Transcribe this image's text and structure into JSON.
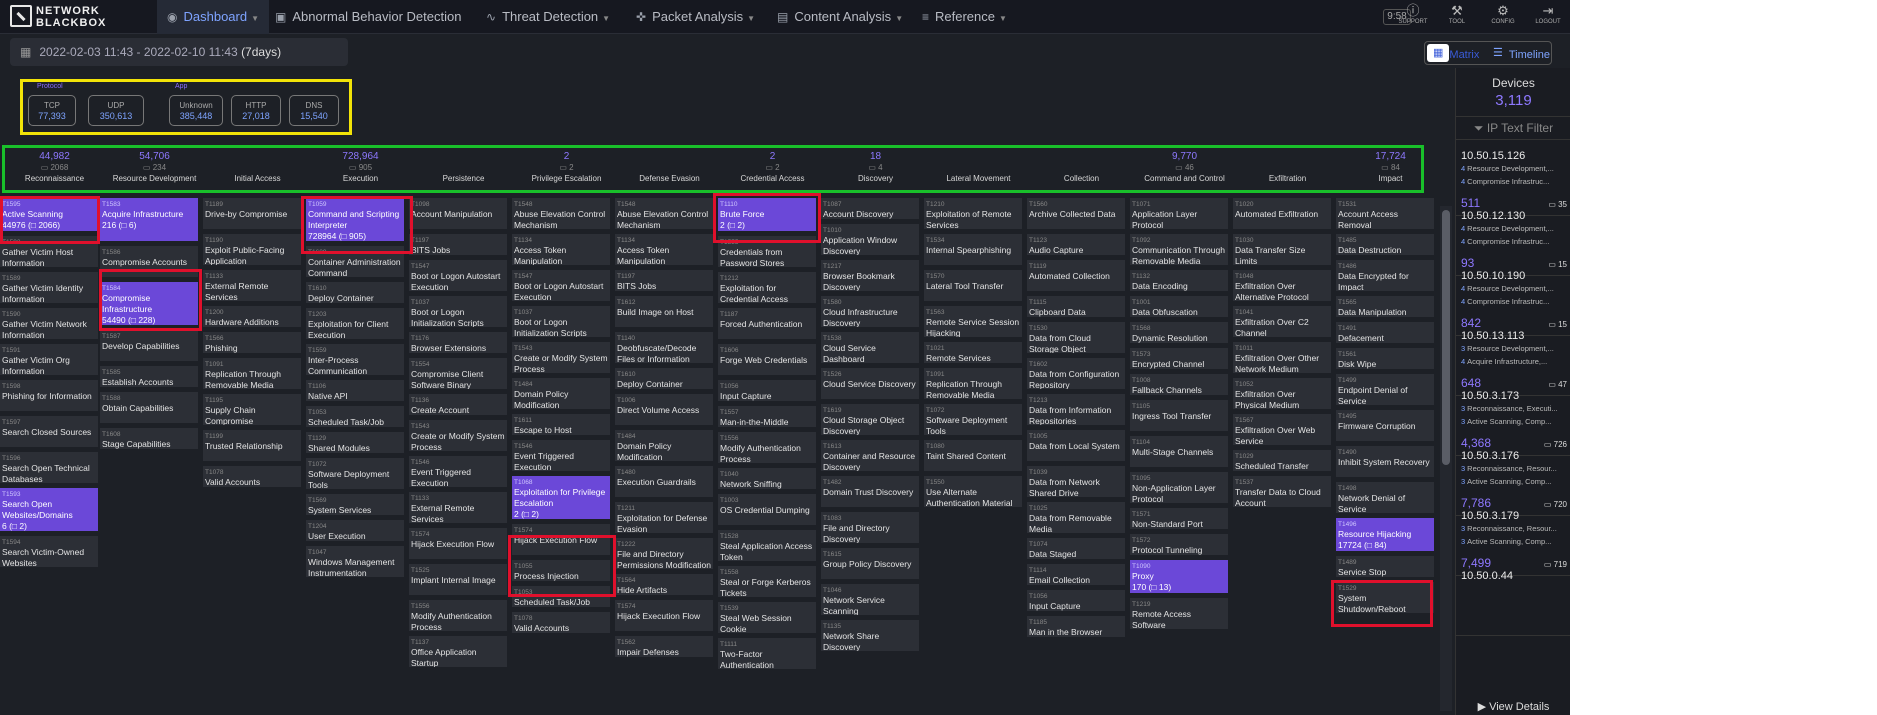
{
  "brand": {
    "line1": "NETWORK",
    "line2": "BLACKBOX"
  },
  "nav": [
    {
      "label": "Dashboard",
      "icon": "◉"
    },
    {
      "label": "Abnormal Behavior Detection",
      "icon": "▣"
    },
    {
      "label": "Threat Detection",
      "icon": "∿"
    },
    {
      "label": "Packet Analysis",
      "icon": "✜"
    },
    {
      "label": "Content Analysis",
      "icon": "▤"
    },
    {
      "label": "Reference",
      "icon": "≡"
    }
  ],
  "clock": "9:58",
  "tools": [
    {
      "label": "SUPPORT",
      "icon": "ⓘ"
    },
    {
      "label": "TOOL",
      "icon": "⚒"
    },
    {
      "label": "CONFIG",
      "icon": "⚙"
    },
    {
      "label": "LOGOUT",
      "icon": "⇥"
    }
  ],
  "date_range": "2022-02-03 11:43 - 2022-02-10 11:43",
  "date_span": "(7days)",
  "view": {
    "matrix": "Matrix",
    "timeline": "Timeline"
  },
  "protocol": {
    "group_protocol": "Protocol",
    "group_app": "App",
    "items": [
      {
        "name": "TCP",
        "value": "77,393"
      },
      {
        "name": "UDP",
        "value": "350,613"
      },
      {
        "name": "Unknown",
        "value": "385,448"
      },
      {
        "name": "HTTP",
        "value": "27,018"
      },
      {
        "name": "DNS",
        "value": "15,540"
      }
    ]
  },
  "tactics": [
    {
      "name": "Reconnaissance",
      "count": "44,982",
      "sub": "2068"
    },
    {
      "name": "Resource Development",
      "count": "54,706",
      "sub": "234"
    },
    {
      "name": "Initial Access",
      "count": "",
      "sub": ""
    },
    {
      "name": "Execution",
      "count": "728,964",
      "sub": "905"
    },
    {
      "name": "Persistence",
      "count": "",
      "sub": ""
    },
    {
      "name": "Privilege Escalation",
      "count": "2",
      "sub": "2"
    },
    {
      "name": "Defense Evasion",
      "count": "",
      "sub": ""
    },
    {
      "name": "Credential Access",
      "count": "2",
      "sub": "2"
    },
    {
      "name": "Discovery",
      "count": "18",
      "sub": "4"
    },
    {
      "name": "Lateral Movement",
      "count": "",
      "sub": ""
    },
    {
      "name": "Collection",
      "count": "",
      "sub": ""
    },
    {
      "name": "Command and Control",
      "count": "9,770",
      "sub": "46"
    },
    {
      "name": "Exfiltration",
      "count": "",
      "sub": ""
    },
    {
      "name": "Impact",
      "count": "17,724",
      "sub": "84"
    }
  ],
  "matrix": [
    [
      {
        "id": "T1595",
        "name": "Active Scanning",
        "count": "44976 (□ 2066)",
        "hot": true
      },
      {
        "id": "T1592",
        "name": "Gather Victim Host Information"
      },
      {
        "id": "T1589",
        "name": "Gather Victim Identity Information"
      },
      {
        "id": "T1590",
        "name": "Gather Victim Network Information"
      },
      {
        "id": "T1591",
        "name": "Gather Victim Org Information"
      },
      {
        "id": "T1598",
        "name": "Phishing for Information"
      },
      {
        "id": "T1597",
        "name": "Search Closed Sources"
      },
      {
        "id": "T1596",
        "name": "Search Open Technical Databases"
      },
      {
        "id": "T1593",
        "name": "Search Open Websites/Domains",
        "count": "6 (□ 2)",
        "hot": true
      },
      {
        "id": "T1594",
        "name": "Search Victim-Owned Websites"
      }
    ],
    [
      {
        "id": "T1583",
        "name": "Acquire Infrastructure",
        "count": "216 (□ 6)",
        "hot": true
      },
      {
        "id": "T1586",
        "name": "Compromise Accounts"
      },
      {
        "id": "T1584",
        "name": "Compromise Infrastructure",
        "count": "54490 (□ 228)",
        "hot": true
      },
      {
        "id": "T1587",
        "name": "Develop Capabilities"
      },
      {
        "id": "T1585",
        "name": "Establish Accounts"
      },
      {
        "id": "T1588",
        "name": "Obtain Capabilities"
      },
      {
        "id": "T1608",
        "name": "Stage Capabilities"
      }
    ],
    [
      {
        "id": "T1189",
        "name": "Drive-by Compromise"
      },
      {
        "id": "T1190",
        "name": "Exploit Public-Facing Application"
      },
      {
        "id": "T1133",
        "name": "External Remote Services"
      },
      {
        "id": "T1200",
        "name": "Hardware Additions"
      },
      {
        "id": "T1566",
        "name": "Phishing"
      },
      {
        "id": "T1091",
        "name": "Replication Through Removable Media"
      },
      {
        "id": "T1195",
        "name": "Supply Chain Compromise"
      },
      {
        "id": "T1199",
        "name": "Trusted Relationship"
      },
      {
        "id": "T1078",
        "name": "Valid Accounts"
      }
    ],
    [
      {
        "id": "T1059",
        "name": "Command and Scripting Interpreter",
        "count": "728964 (□ 905)",
        "hot": true
      },
      {
        "id": "T1609",
        "name": "Container Administration Command"
      },
      {
        "id": "T1610",
        "name": "Deploy Container"
      },
      {
        "id": "T1203",
        "name": "Exploitation for Client Execution"
      },
      {
        "id": "T1559",
        "name": "Inter-Process Communication"
      },
      {
        "id": "T1106",
        "name": "Native API"
      },
      {
        "id": "T1053",
        "name": "Scheduled Task/Job"
      },
      {
        "id": "T1129",
        "name": "Shared Modules"
      },
      {
        "id": "T1072",
        "name": "Software Deployment Tools"
      },
      {
        "id": "T1569",
        "name": "System Services"
      },
      {
        "id": "T1204",
        "name": "User Execution"
      },
      {
        "id": "T1047",
        "name": "Windows Management Instrumentation"
      }
    ],
    [
      {
        "id": "T1098",
        "name": "Account Manipulation"
      },
      {
        "id": "T1197",
        "name": "BITS Jobs"
      },
      {
        "id": "T1547",
        "name": "Boot or Logon Autostart Execution"
      },
      {
        "id": "T1037",
        "name": "Boot or Logon Initialization Scripts"
      },
      {
        "id": "T1176",
        "name": "Browser Extensions"
      },
      {
        "id": "T1554",
        "name": "Compromise Client Software Binary"
      },
      {
        "id": "T1136",
        "name": "Create Account"
      },
      {
        "id": "T1543",
        "name": "Create or Modify System Process"
      },
      {
        "id": "T1546",
        "name": "Event Triggered Execution"
      },
      {
        "id": "T1133",
        "name": "External Remote Services"
      },
      {
        "id": "T1574",
        "name": "Hijack Execution Flow"
      },
      {
        "id": "T1525",
        "name": "Implant Internal Image"
      },
      {
        "id": "T1556",
        "name": "Modify Authentication Process"
      },
      {
        "id": "T1137",
        "name": "Office Application Startup"
      }
    ],
    [
      {
        "id": "T1548",
        "name": "Abuse Elevation Control Mechanism"
      },
      {
        "id": "T1134",
        "name": "Access Token Manipulation"
      },
      {
        "id": "T1547",
        "name": "Boot or Logon Autostart Execution"
      },
      {
        "id": "T1037",
        "name": "Boot or Logon Initialization Scripts"
      },
      {
        "id": "T1543",
        "name": "Create or Modify System Process"
      },
      {
        "id": "T1484",
        "name": "Domain Policy Modification"
      },
      {
        "id": "T1611",
        "name": "Escape to Host"
      },
      {
        "id": "T1546",
        "name": "Event Triggered Execution"
      },
      {
        "id": "T1068",
        "name": "Exploitation for Privilege Escalation",
        "count": "2 (□ 2)",
        "hot": true
      },
      {
        "id": "T1574",
        "name": "Hijack Execution Flow"
      },
      {
        "id": "T1055",
        "name": "Process Injection"
      },
      {
        "id": "T1053",
        "name": "Scheduled Task/Job"
      },
      {
        "id": "T1078",
        "name": "Valid Accounts"
      }
    ],
    [
      {
        "id": "T1548",
        "name": "Abuse Elevation Control Mechanism"
      },
      {
        "id": "T1134",
        "name": "Access Token Manipulation"
      },
      {
        "id": "T1197",
        "name": "BITS Jobs"
      },
      {
        "id": "T1612",
        "name": "Build Image on Host"
      },
      {
        "id": "T1140",
        "name": "Deobfuscate/Decode Files or Information"
      },
      {
        "id": "T1610",
        "name": "Deploy Container"
      },
      {
        "id": "T1006",
        "name": "Direct Volume Access"
      },
      {
        "id": "T1484",
        "name": "Domain Policy Modification"
      },
      {
        "id": "T1480",
        "name": "Execution Guardrails"
      },
      {
        "id": "T1211",
        "name": "Exploitation for Defense Evasion"
      },
      {
        "id": "T1222",
        "name": "File and Directory Permissions Modification"
      },
      {
        "id": "T1564",
        "name": "Hide Artifacts"
      },
      {
        "id": "T1574",
        "name": "Hijack Execution Flow"
      },
      {
        "id": "T1562",
        "name": "Impair Defenses"
      }
    ],
    [
      {
        "id": "T1110",
        "name": "Brute Force",
        "count": "2 (□ 2)",
        "hot": true
      },
      {
        "id": "T1555",
        "name": "Credentials from Password Stores"
      },
      {
        "id": "T1212",
        "name": "Exploitation for Credential Access"
      },
      {
        "id": "T1187",
        "name": "Forced Authentication"
      },
      {
        "id": "T1606",
        "name": "Forge Web Credentials"
      },
      {
        "id": "T1056",
        "name": "Input Capture"
      },
      {
        "id": "T1557",
        "name": "Man-in-the-Middle"
      },
      {
        "id": "T1556",
        "name": "Modify Authentication Process"
      },
      {
        "id": "T1040",
        "name": "Network Sniffing"
      },
      {
        "id": "T1003",
        "name": "OS Credential Dumping"
      },
      {
        "id": "T1528",
        "name": "Steal Application Access Token"
      },
      {
        "id": "T1558",
        "name": "Steal or Forge Kerberos Tickets"
      },
      {
        "id": "T1539",
        "name": "Steal Web Session Cookie"
      },
      {
        "id": "T1111",
        "name": "Two-Factor Authentication Interception"
      }
    ],
    [
      {
        "id": "T1087",
        "name": "Account Discovery"
      },
      {
        "id": "T1010",
        "name": "Application Window Discovery"
      },
      {
        "id": "T1217",
        "name": "Browser Bookmark Discovery"
      },
      {
        "id": "T1580",
        "name": "Cloud Infrastructure Discovery"
      },
      {
        "id": "T1538",
        "name": "Cloud Service Dashboard"
      },
      {
        "id": "T1526",
        "name": "Cloud Service Discovery"
      },
      {
        "id": "T1619",
        "name": "Cloud Storage Object Discovery"
      },
      {
        "id": "T1613",
        "name": "Container and Resource Discovery"
      },
      {
        "id": "T1482",
        "name": "Domain Trust Discovery"
      },
      {
        "id": "T1083",
        "name": "File and Directory Discovery"
      },
      {
        "id": "T1615",
        "name": "Group Policy Discovery"
      },
      {
        "id": "T1046",
        "name": "Network Service Scanning"
      },
      {
        "id": "T1135",
        "name": "Network Share Discovery"
      }
    ],
    [
      {
        "id": "T1210",
        "name": "Exploitation of Remote Services"
      },
      {
        "id": "T1534",
        "name": "Internal Spearphishing"
      },
      {
        "id": "T1570",
        "name": "Lateral Tool Transfer"
      },
      {
        "id": "T1563",
        "name": "Remote Service Session Hijacking"
      },
      {
        "id": "T1021",
        "name": "Remote Services"
      },
      {
        "id": "T1091",
        "name": "Replication Through Removable Media"
      },
      {
        "id": "T1072",
        "name": "Software Deployment Tools"
      },
      {
        "id": "T1080",
        "name": "Taint Shared Content"
      },
      {
        "id": "T1550",
        "name": "Use Alternate Authentication Material"
      }
    ],
    [
      {
        "id": "T1560",
        "name": "Archive Collected Data"
      },
      {
        "id": "T1123",
        "name": "Audio Capture"
      },
      {
        "id": "T1119",
        "name": "Automated Collection"
      },
      {
        "id": "T1115",
        "name": "Clipboard Data"
      },
      {
        "id": "T1530",
        "name": "Data from Cloud Storage Object"
      },
      {
        "id": "T1602",
        "name": "Data from Configuration Repository"
      },
      {
        "id": "T1213",
        "name": "Data from Information Repositories"
      },
      {
        "id": "T1005",
        "name": "Data from Local System"
      },
      {
        "id": "T1039",
        "name": "Data from Network Shared Drive"
      },
      {
        "id": "T1025",
        "name": "Data from Removable Media"
      },
      {
        "id": "T1074",
        "name": "Data Staged"
      },
      {
        "id": "T1114",
        "name": "Email Collection"
      },
      {
        "id": "T1056",
        "name": "Input Capture"
      },
      {
        "id": "T1185",
        "name": "Man in the Browser"
      }
    ],
    [
      {
        "id": "T1071",
        "name": "Application Layer Protocol"
      },
      {
        "id": "T1092",
        "name": "Communication Through Removable Media"
      },
      {
        "id": "T1132",
        "name": "Data Encoding"
      },
      {
        "id": "T1001",
        "name": "Data Obfuscation"
      },
      {
        "id": "T1568",
        "name": "Dynamic Resolution"
      },
      {
        "id": "T1573",
        "name": "Encrypted Channel"
      },
      {
        "id": "T1008",
        "name": "Fallback Channels"
      },
      {
        "id": "T1105",
        "name": "Ingress Tool Transfer"
      },
      {
        "id": "T1104",
        "name": "Multi-Stage Channels"
      },
      {
        "id": "T1095",
        "name": "Non-Application Layer Protocol"
      },
      {
        "id": "T1571",
        "name": "Non-Standard Port"
      },
      {
        "id": "T1572",
        "name": "Protocol Tunneling"
      },
      {
        "id": "T1090",
        "name": "Proxy",
        "count": "170 (□ 13)",
        "hot": true
      },
      {
        "id": "T1219",
        "name": "Remote Access Software"
      }
    ],
    [
      {
        "id": "T1020",
        "name": "Automated Exfiltration"
      },
      {
        "id": "T1030",
        "name": "Data Transfer Size Limits"
      },
      {
        "id": "T1048",
        "name": "Exfiltration Over Alternative Protocol"
      },
      {
        "id": "T1041",
        "name": "Exfiltration Over C2 Channel"
      },
      {
        "id": "T1011",
        "name": "Exfiltration Over Other Network Medium"
      },
      {
        "id": "T1052",
        "name": "Exfiltration Over Physical Medium"
      },
      {
        "id": "T1567",
        "name": "Exfiltration Over Web Service"
      },
      {
        "id": "T1029",
        "name": "Scheduled Transfer"
      },
      {
        "id": "T1537",
        "name": "Transfer Data to Cloud Account"
      }
    ],
    [
      {
        "id": "T1531",
        "name": "Account Access Removal"
      },
      {
        "id": "T1485",
        "name": "Data Destruction"
      },
      {
        "id": "T1486",
        "name": "Data Encrypted for Impact"
      },
      {
        "id": "T1565",
        "name": "Data Manipulation"
      },
      {
        "id": "T1491",
        "name": "Defacement"
      },
      {
        "id": "T1561",
        "name": "Disk Wipe"
      },
      {
        "id": "T1499",
        "name": "Endpoint Denial of Service"
      },
      {
        "id": "T1495",
        "name": "Firmware Corruption"
      },
      {
        "id": "T1490",
        "name": "Inhibit System Recovery"
      },
      {
        "id": "T1498",
        "name": "Network Denial of Service"
      },
      {
        "id": "T1496",
        "name": "Resource Hijacking",
        "count": "17724 (□ 84)",
        "hot": true
      },
      {
        "id": "T1489",
        "name": "Service Stop"
      },
      {
        "id": "T1529",
        "name": "System Shutdown/Reboot"
      }
    ]
  ],
  "devices": {
    "title": "Devices",
    "count": "3,119",
    "filter": "IP Text Filter",
    "view_details": "View Details",
    "list": [
      {
        "ip": "10.50.15.126",
        "l1n": "4",
        "l1": "Resource Development,...",
        "l2n": "4",
        "l2": "Compromise Infrastruc...",
        "count": "511",
        "sub": "35"
      },
      {
        "ip": "10.50.12.130",
        "l1n": "4",
        "l1": "Resource Development,...",
        "l2n": "4",
        "l2": "Compromise Infrastruc...",
        "count": "93",
        "sub": "15"
      },
      {
        "ip": "10.50.10.190",
        "l1n": "4",
        "l1": "Resource Development,...",
        "l2n": "4",
        "l2": "Compromise Infrastruc...",
        "count": "842",
        "sub": "15"
      },
      {
        "ip": "10.50.13.113",
        "l1n": "3",
        "l1": "Resource Development,...",
        "l2n": "4",
        "l2": "Acquire Infrastructure,...",
        "count": "648",
        "sub": "47"
      },
      {
        "ip": "10.50.3.173",
        "l1n": "3",
        "l1": "Reconnaissance, Executi...",
        "l2n": "3",
        "l2": "Active Scanning, Comp...",
        "count": "4,368",
        "sub": "726"
      },
      {
        "ip": "10.50.3.176",
        "l1n": "3",
        "l1": "Reconnaissance, Resour...",
        "l2n": "3",
        "l2": "Active Scanning, Comp...",
        "count": "7,786",
        "sub": "720"
      },
      {
        "ip": "10.50.3.179",
        "l1n": "3",
        "l1": "Reconnaissance, Resour...",
        "l2n": "3",
        "l2": "Active Scanning, Comp...",
        "count": "7,499",
        "sub": "719"
      },
      {
        "ip": "10.50.0.44",
        "l1n": "",
        "l1": "",
        "l2n": "",
        "l2": "",
        "count": "",
        "sub": ""
      }
    ]
  }
}
